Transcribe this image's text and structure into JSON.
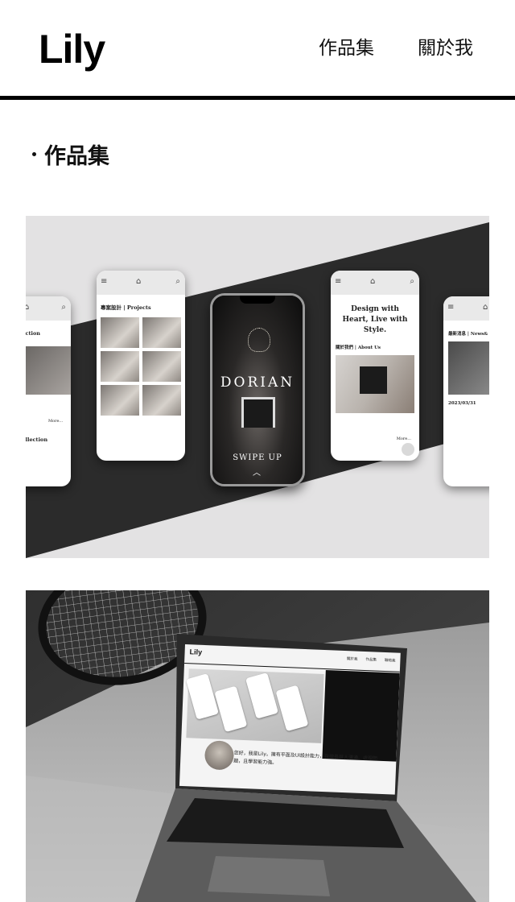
{
  "header": {
    "logo": "Lily",
    "nav": [
      "作品集",
      "關於我"
    ]
  },
  "section": {
    "title": "作品集"
  },
  "card1": {
    "left_phone": {
      "title_a": "ge Collection",
      "title_b": "iture Collection",
      "more": "More..."
    },
    "projects_phone": {
      "heading": "專案設計 | Projects"
    },
    "center_phone": {
      "brand": "DORIAN",
      "swipe": "SWIPE UP"
    },
    "about_phone": {
      "heading": "Design with Heart, Live with Style.",
      "sub": "關於我們 | About Us",
      "more": "More..."
    },
    "news_phone": {
      "heading": "最新消息 | News&",
      "date": "2023/03/31"
    }
  },
  "card2": {
    "screen": {
      "logo": "Lily",
      "nav": [
        "關於我",
        "作品集",
        "聯絡我"
      ],
      "intro": "您好，我是Lily。擁有平面及UI設計能力，我擅長與人溝通、處理問題，且學習能力強。"
    }
  },
  "colors": {
    "text": "#111111",
    "header_rule": "#000000",
    "card1_bg": "#e3e2e3",
    "card1_band": "#2b2b2b"
  }
}
